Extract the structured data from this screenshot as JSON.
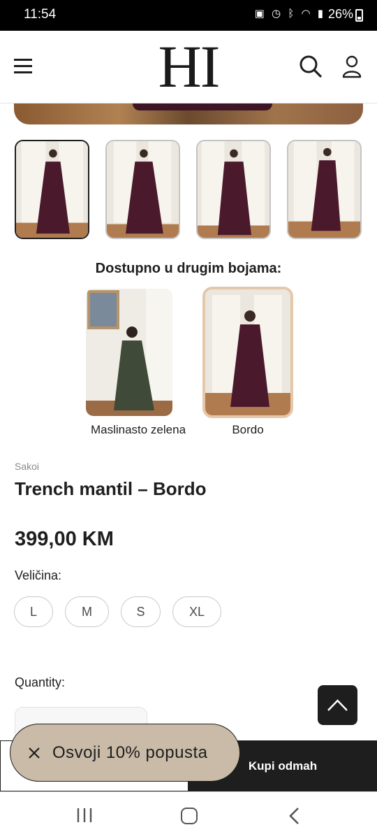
{
  "status_bar": {
    "time": "11:54",
    "icons": [
      "photo-icon",
      "alarm-icon",
      "bluetooth-icon",
      "wifi-icon",
      "signal-icon"
    ],
    "battery": "26%"
  },
  "header": {
    "logo": "HI",
    "icons": [
      "menu-icon",
      "search-icon",
      "account-icon"
    ]
  },
  "gallery": {
    "thumbnail_count": 4,
    "active_index": 0
  },
  "colors": {
    "title": "Dostupno u drugim bojama:",
    "options": [
      {
        "label": "Maslinasto zelena",
        "color": "#3f4a38"
      },
      {
        "label": "Bordo",
        "color": "#4a1a2c",
        "selected": true
      }
    ]
  },
  "product": {
    "category": "Sakoi",
    "title": "Trench mantil – Bordo",
    "price": "399,00 KM"
  },
  "size": {
    "label": "Veličina:",
    "options": [
      "L",
      "M",
      "S",
      "XL"
    ]
  },
  "quantity": {
    "label": "Quantity:"
  },
  "actions": {
    "buy_now": "Kupi odmah"
  },
  "promo": {
    "text": "Osvoji 10% popusta"
  },
  "theme": {
    "accent_dark": "#1e1e1e",
    "promo_bg": "#c9bba7",
    "coat_bordo": "#4a1a2c",
    "coat_green": "#3f4a38",
    "selected_border": "#e5c7a9"
  }
}
